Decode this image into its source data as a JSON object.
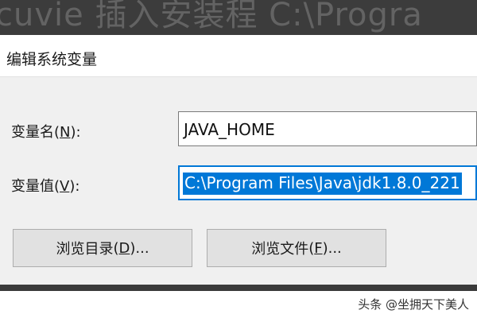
{
  "background_window": {
    "text": "cuvie   插入安装程   C:\\Progra"
  },
  "dialog": {
    "title": "编辑系统变量",
    "name_label": "变量名",
    "name_hotkey": "N",
    "name_value": "JAVA_HOME",
    "value_label": "变量值",
    "value_hotkey": "V",
    "value_value": "C:\\Program Files\\Java\\jdk1.8.0_221",
    "browse_dir_label": "浏览目录",
    "browse_dir_hotkey": "D",
    "browse_file_label": "浏览文件",
    "browse_file_hotkey": "F"
  },
  "watermark": "头条 @坐拥天下美人",
  "colors": {
    "selection": "#0078d7",
    "dialog_bg": "#f0f0f0",
    "button_bg": "#e1e1e1"
  }
}
